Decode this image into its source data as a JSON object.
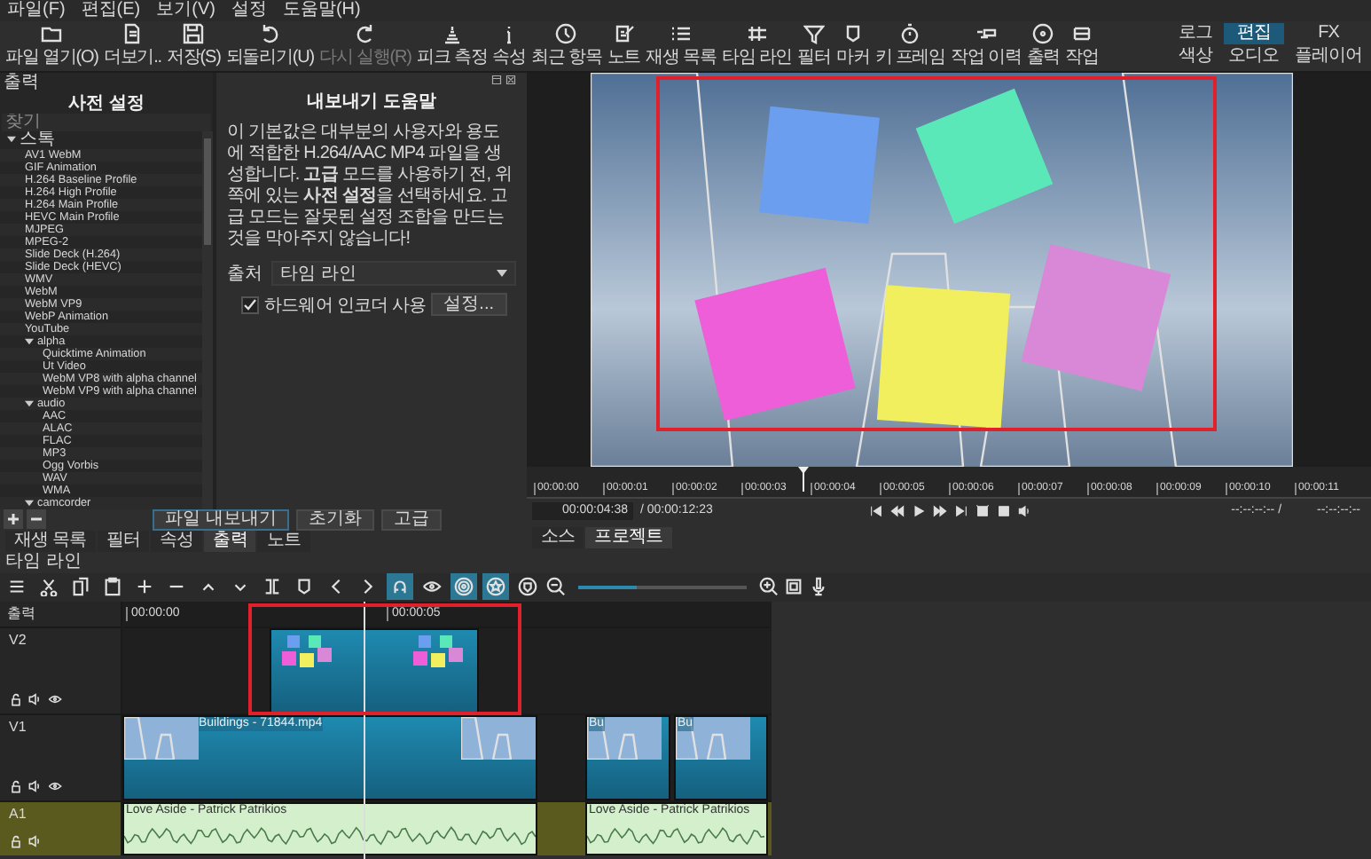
{
  "menu": [
    "파일(F)",
    "편집(E)",
    "보기(V)",
    "설정",
    "도움말(H)"
  ],
  "toolbar": [
    {
      "label": "파일 열기(O)",
      "kind": "folder",
      "disabled": false
    },
    {
      "label": "더보기..",
      "kind": "document",
      "disabled": false
    },
    {
      "label": "저장(S)",
      "kind": "floppy",
      "disabled": false
    },
    {
      "label": "되돌리기(U)",
      "kind": "undo",
      "disabled": false
    },
    {
      "label": "다시 실행(R)",
      "kind": "redo",
      "disabled": true
    },
    {
      "label": "피크 측정",
      "kind": "meter",
      "disabled": false
    },
    {
      "label": "속성",
      "kind": "info",
      "disabled": false
    },
    {
      "label": "최근 항목",
      "kind": "clock",
      "disabled": false
    },
    {
      "label": "노트",
      "kind": "note",
      "disabled": false
    },
    {
      "label": "재생 목록",
      "kind": "list",
      "disabled": false
    },
    {
      "label": "타임 라인",
      "kind": "tracks",
      "disabled": false
    },
    {
      "label": "필터",
      "kind": "funnel",
      "disabled": false
    },
    {
      "label": "마커",
      "kind": "marker",
      "disabled": false
    },
    {
      "label": "키 프레임",
      "kind": "stopwatch",
      "disabled": false
    },
    {
      "label": "작업 이력",
      "kind": "history",
      "disabled": false
    },
    {
      "label": "출력",
      "kind": "disc",
      "disabled": false
    },
    {
      "label": "작업",
      "kind": "stack",
      "disabled": false
    }
  ],
  "layouts": [
    {
      "label": "로그",
      "selected": false
    },
    {
      "label": "편집",
      "selected": true
    },
    {
      "label": "FX",
      "selected": false
    },
    {
      "label": "색상",
      "selected": false
    },
    {
      "label": "오디오",
      "selected": false
    },
    {
      "label": "플레이어",
      "selected": false
    }
  ],
  "presets": {
    "title": "출력",
    "heading": "사전 설정",
    "search": {
      "placeholder": "찾기"
    },
    "tree": [
      {
        "label": "스톡",
        "expanded": true,
        "children": [
          {
            "label": "AV1 WebM"
          },
          {
            "label": "GIF Animation"
          },
          {
            "label": "H.264 Baseline Profile"
          },
          {
            "label": "H.264 High Profile"
          },
          {
            "label": "H.264 Main Profile"
          },
          {
            "label": "HEVC Main Profile"
          },
          {
            "label": "MJPEG"
          },
          {
            "label": "MPEG-2"
          },
          {
            "label": "Slide Deck (H.264)"
          },
          {
            "label": "Slide Deck (HEVC)"
          },
          {
            "label": "WMV"
          },
          {
            "label": "WebM"
          },
          {
            "label": "WebM VP9"
          },
          {
            "label": "WebP Animation"
          },
          {
            "label": "YouTube"
          },
          {
            "label": "alpha",
            "expanded": true,
            "children": [
              {
                "label": "Quicktime Animation"
              },
              {
                "label": "Ut Video"
              },
              {
                "label": "WebM VP8 with alpha channel"
              },
              {
                "label": "WebM VP9 with alpha channel"
              }
            ]
          },
          {
            "label": "audio",
            "expanded": true,
            "children": [
              {
                "label": "AAC"
              },
              {
                "label": "ALAC"
              },
              {
                "label": "FLAC"
              },
              {
                "label": "MP3"
              },
              {
                "label": "Ogg Vorbis"
              },
              {
                "label": "WAV"
              },
              {
                "label": "WMA"
              }
            ]
          },
          {
            "label": "camcorder",
            "expanded": true
          }
        ]
      }
    ]
  },
  "export": {
    "title": "내보내기 도움말",
    "help": "이 기본값은 대부분의 사용자와 용도에 적합한 H.264/AAC MP4 파일을 생성합니다. **고급** 모드를 사용하기 전, 위쪽에 있는 **사전 설정**을 선택하세요. 고급 모드는 잘못된 설정 조합을 만드는 것을 막아주지 않습니다!",
    "from_label": "출처",
    "from_value": "타임 라인",
    "hw_encoder": {
      "label": "하드웨어 인코더 사용",
      "checked": true
    },
    "settings_button": "설정...",
    "buttons": [
      "파일 내보내기",
      "초기화",
      "고급"
    ]
  },
  "left_tabs": [
    {
      "label": "재생 목록",
      "selected": false
    },
    {
      "label": "필터",
      "selected": false
    },
    {
      "label": "속성",
      "selected": false
    },
    {
      "label": "출력",
      "selected": true
    },
    {
      "label": "노트",
      "selected": false
    }
  ],
  "player": {
    "ruler": [
      "00:00:00",
      "00:00:01",
      "00:00:02",
      "00:00:03",
      "00:00:04",
      "00:00:05",
      "00:00:06",
      "00:00:07",
      "00:00:08",
      "00:00:09",
      "00:00:10",
      "00:00:11"
    ],
    "position": "00:00:04:38",
    "duration": "/ 00:00:12:23",
    "in_point": "--:--:--:-- /",
    "out_point": "--:--:--:--",
    "tabs": [
      {
        "label": "소스",
        "selected": false
      },
      {
        "label": "프로젝트",
        "selected": true
      }
    ]
  },
  "timeline": {
    "title": "타임 라인",
    "output_label": "출력",
    "ruler": [
      "00:00:00",
      "00:00:05"
    ],
    "tools": [
      {
        "kind": "menu",
        "on": false
      },
      {
        "kind": "scissors",
        "on": false
      },
      {
        "kind": "copy",
        "on": false
      },
      {
        "kind": "paste",
        "on": false
      },
      {
        "kind": "plus",
        "on": false
      },
      {
        "kind": "minus",
        "on": false
      },
      {
        "kind": "up",
        "on": false
      },
      {
        "kind": "down",
        "on": false
      },
      {
        "kind": "split",
        "on": false
      },
      {
        "kind": "marker",
        "on": false
      },
      {
        "kind": "prev",
        "on": false
      },
      {
        "kind": "next",
        "on": false
      },
      {
        "kind": "magnet",
        "on": true
      },
      {
        "kind": "eye",
        "on": false
      },
      {
        "kind": "ripple",
        "on": true
      },
      {
        "kind": "ripple-all",
        "on": true
      },
      {
        "kind": "shield",
        "on": false
      }
    ],
    "zoom": {
      "level": 0.35
    },
    "tracks": [
      {
        "name": "V2",
        "kind": "video",
        "clips": [
          {
            "kind": "notes"
          }
        ]
      },
      {
        "name": "V1",
        "kind": "video",
        "clips": [
          {
            "label": "Buildings - 71844.mp4",
            "kind": "city"
          },
          {
            "label": "Bu",
            "kind": "city"
          },
          {
            "label": "Bu",
            "kind": "city"
          }
        ]
      },
      {
        "name": "A1",
        "kind": "audio",
        "clips": [
          {
            "label": "Love Aside - Patrick Patrikios"
          },
          {
            "label": "Love Aside - Patrick Patrikios"
          }
        ]
      }
    ]
  }
}
